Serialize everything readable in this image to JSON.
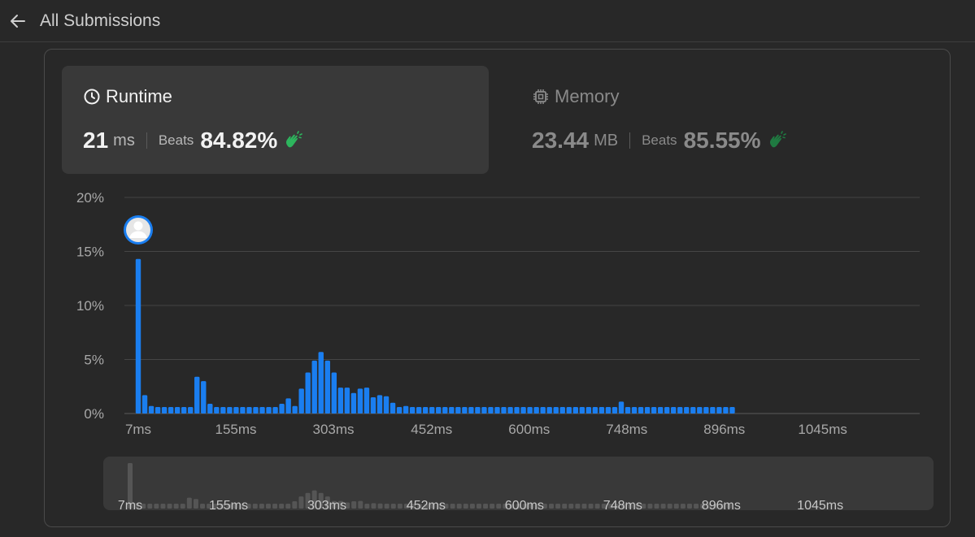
{
  "header": {
    "title": "All Submissions",
    "back_icon": "arrow-left-icon"
  },
  "runtime": {
    "label": "Runtime",
    "value": "21",
    "unit": "ms",
    "beats_label": "Beats",
    "beats_value": "84.82%",
    "icon": "clock-icon"
  },
  "memory": {
    "label": "Memory",
    "value": "23.44",
    "unit": "MB",
    "beats_label": "Beats",
    "beats_value": "85.55%",
    "icon": "chip-icon"
  },
  "colors": {
    "bar": "#1a7ef0",
    "clap": "#2db55d",
    "overview_bar": "#555555"
  },
  "chart_data": {
    "type": "bar",
    "y_ticks": [
      "20%",
      "15%",
      "10%",
      "5%",
      "0%"
    ],
    "ylim": [
      0,
      20
    ],
    "x_ticks": [
      "7ms",
      "155ms",
      "303ms",
      "452ms",
      "600ms",
      "748ms",
      "896ms",
      "1045ms"
    ],
    "x_range": [
      7,
      1200
    ],
    "bar_width_ms": 9.9,
    "highlighted_bar": 0,
    "grid": true,
    "values": [
      14.3,
      1.7,
      0.7,
      0.6,
      0.6,
      0.6,
      0.6,
      0.6,
      0.6,
      3.4,
      3.0,
      0.9,
      0.6,
      0.6,
      0.6,
      0.6,
      0.6,
      0.6,
      0.6,
      0.6,
      0.6,
      0.6,
      0.9,
      1.4,
      0.7,
      2.3,
      3.8,
      4.9,
      5.7,
      4.9,
      3.8,
      2.4,
      2.4,
      1.9,
      2.3,
      2.4,
      1.5,
      1.7,
      1.6,
      1.0,
      0.6,
      0.7,
      0.6,
      0.6,
      0.6,
      0.6,
      0.6,
      0.6,
      0.6,
      0.6,
      0.6,
      0.6,
      0.6,
      0.6,
      0.6,
      0.6,
      0.6,
      0.6,
      0.6,
      0.6,
      0.6,
      0.6,
      0.6,
      0.6,
      0.6,
      0.6,
      0.6,
      0.6,
      0.6,
      0.6,
      0.6,
      0.6,
      0.6,
      0.6,
      1.1,
      0.6,
      0.6,
      0.6,
      0.6,
      0.6,
      0.6,
      0.6,
      0.6,
      0.6,
      0.6,
      0.6,
      0.6,
      0.6,
      0.6,
      0.6,
      0.6,
      0.6
    ]
  }
}
